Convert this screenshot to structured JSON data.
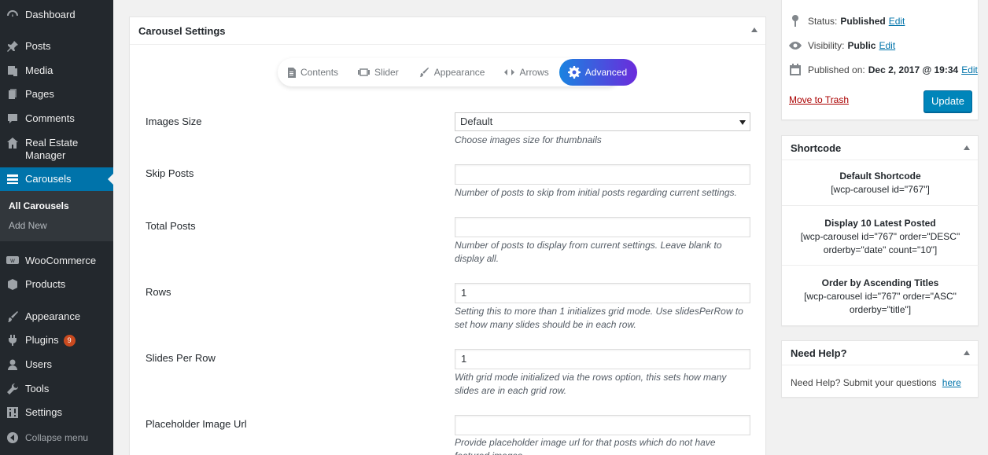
{
  "sidebar": {
    "items": [
      {
        "label": "Dashboard",
        "icon": "dashboard-icon"
      },
      {
        "label": "Posts",
        "icon": "pin-icon"
      },
      {
        "label": "Media",
        "icon": "media-icon"
      },
      {
        "label": "Pages",
        "icon": "pages-icon"
      },
      {
        "label": "Comments",
        "icon": "comment-icon"
      },
      {
        "label": "Real Estate Manager",
        "icon": "home-icon"
      },
      {
        "label": "Carousels",
        "icon": "carousel-icon"
      },
      {
        "label": "WooCommerce",
        "icon": "woo-icon"
      },
      {
        "label": "Products",
        "icon": "products-icon"
      },
      {
        "label": "Appearance",
        "icon": "brush-icon"
      },
      {
        "label": "Plugins",
        "icon": "plugin-icon",
        "badge": "9"
      },
      {
        "label": "Users",
        "icon": "user-icon"
      },
      {
        "label": "Tools",
        "icon": "wrench-icon"
      },
      {
        "label": "Settings",
        "icon": "settings-icon"
      }
    ],
    "submenu": [
      "All Carousels",
      "Add New"
    ],
    "collapse_label": "Collapse menu"
  },
  "carousel_settings": {
    "title": "Carousel Settings",
    "tabs": [
      "Contents",
      "Slider",
      "Appearance",
      "Arrows",
      "Advanced"
    ],
    "active_tab": "Advanced",
    "fields": [
      {
        "label": "Images Size",
        "value": "Default",
        "description": "Choose images size for thumbnails"
      },
      {
        "label": "Skip Posts",
        "value": "",
        "description": "Number of posts to skip from initial posts regarding current settings."
      },
      {
        "label": "Total Posts",
        "value": "",
        "description": "Number of posts to display from current settings. Leave blank to display all."
      },
      {
        "label": "Rows",
        "value": "1",
        "description": "Setting this to more than 1 initializes grid mode. Use slidesPerRow to set how many slides should be in each row."
      },
      {
        "label": "Slides Per Row",
        "value": "1",
        "description": "With grid mode initialized via the rows option, this sets how many slides are in each grid row."
      },
      {
        "label": "Placeholder Image Url",
        "value": "",
        "description": "Provide placeholder image url for that posts which do not have featured images."
      }
    ]
  },
  "publish": {
    "status_label": "Status:",
    "status_value": "Published",
    "visibility_label": "Visibility:",
    "visibility_value": "Public",
    "published_label": "Published on:",
    "published_value": "Dec 2, 2017 @ 19:34",
    "edit_label": "Edit",
    "trash_label": "Move to Trash",
    "update_label": "Update"
  },
  "shortcode": {
    "title": "Shortcode",
    "items": [
      {
        "title": "Default Shortcode",
        "code": "[wcp-carousel id=\"767\"]"
      },
      {
        "title": "Display 10 Latest Posted",
        "code": "[wcp-carousel id=\"767\" order=\"DESC\" orderby=\"date\" count=\"10\"]"
      },
      {
        "title": "Order by Ascending Titles",
        "code": "[wcp-carousel id=\"767\" order=\"ASC\" orderby=\"title\"]"
      }
    ]
  },
  "help": {
    "title": "Need Help?",
    "text": "Need Help? Submit your questions",
    "link": "here"
  },
  "colors": {
    "sidebar_bg": "#23282d",
    "accent": "#0073aa",
    "tab_gradient_start": "#1a83e0",
    "tab_gradient_end": "#6b2bdc"
  }
}
